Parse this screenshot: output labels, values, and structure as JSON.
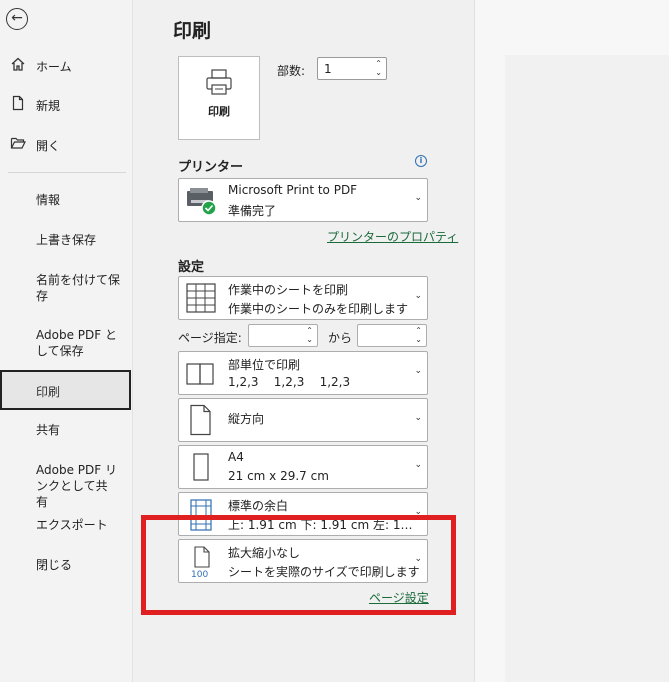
{
  "sidebar": {
    "top_items": [
      {
        "label": "ホーム",
        "icon": "home-icon"
      },
      {
        "label": "新規",
        "icon": "new-document-icon"
      },
      {
        "label": "開く",
        "icon": "open-folder-icon"
      }
    ],
    "items": [
      {
        "label": "情報"
      },
      {
        "label": "上書き保存"
      },
      {
        "label": "名前を付けて保存"
      },
      {
        "label": "Adobe PDF として保存"
      },
      {
        "label": "印刷"
      },
      {
        "label": "共有"
      },
      {
        "label": "Adobe PDF リンクとして共有"
      },
      {
        "label": "エクスポート"
      },
      {
        "label": "閉じる"
      }
    ]
  },
  "print": {
    "title": "印刷",
    "button_label": "印刷",
    "copies_label": "部数:",
    "copies_value": "1"
  },
  "printer": {
    "heading": "プリンター",
    "name": "Microsoft Print to PDF",
    "status": "準備完了",
    "properties_link": "プリンターのプロパティ"
  },
  "settings": {
    "heading": "設定",
    "scope": {
      "title": "作業中のシートを印刷",
      "desc": "作業中のシートのみを印刷します"
    },
    "pages_label": "ページ指定:",
    "to_label": "から",
    "collate": {
      "title": "部単位で印刷",
      "desc": "1,2,3    1,2,3    1,2,3"
    },
    "orientation": {
      "title": "縦方向"
    },
    "paper": {
      "title": "A4",
      "desc": "21 cm x 29.7 cm"
    },
    "margins": {
      "title": "標準の余白",
      "desc": "上: 1.91 cm 下: 1.91 cm 左: 1…"
    },
    "scaling": {
      "title": "拡大縮小なし",
      "desc": "シートを実際のサイズで印刷します",
      "icon_text": "100"
    },
    "page_setup_link": "ページ設定"
  },
  "colors": {
    "highlight": "#e02020",
    "link": "#1a6a3a",
    "printer_ok": "#22a34a"
  }
}
